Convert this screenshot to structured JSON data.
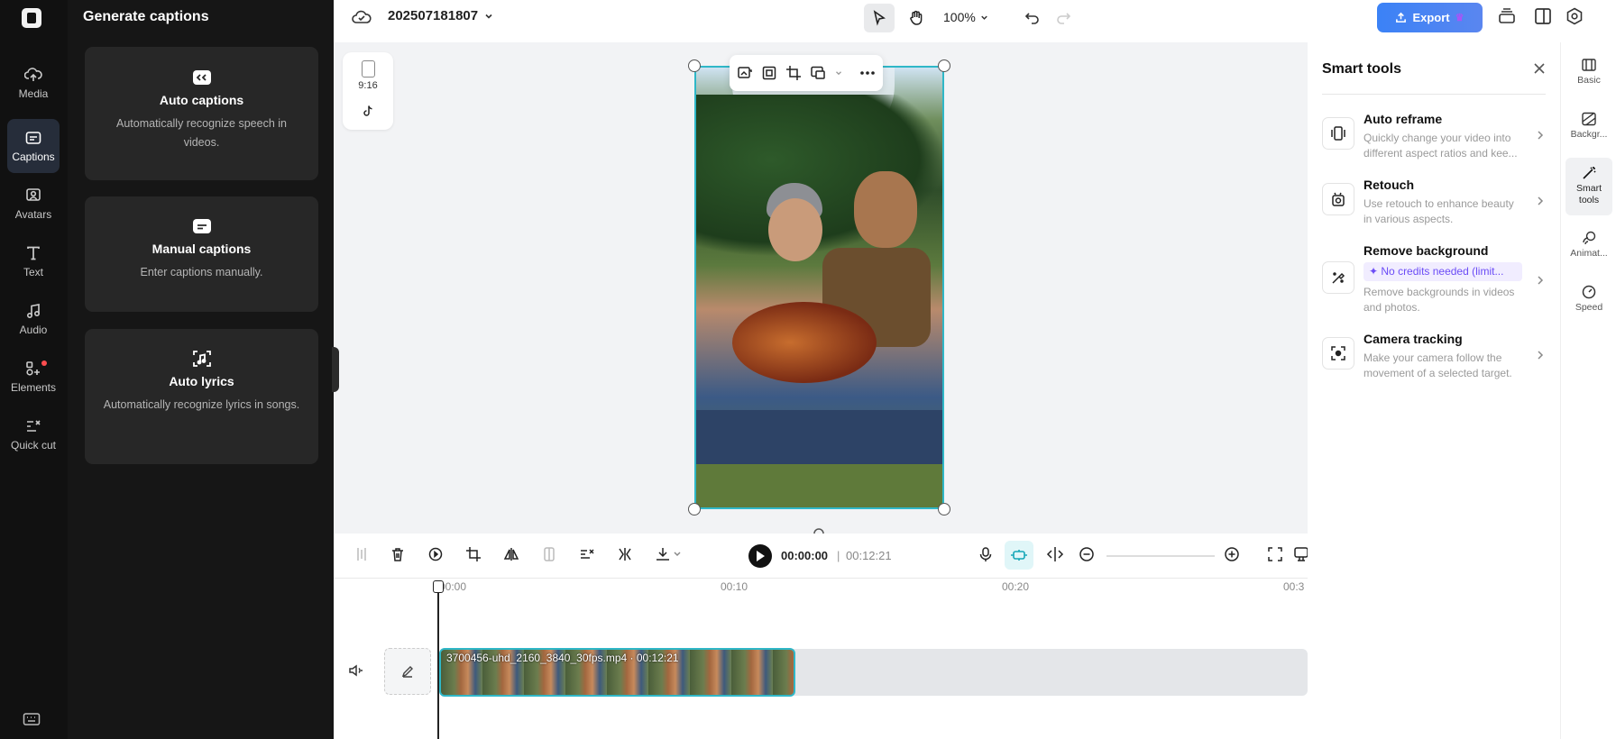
{
  "sidebar": {
    "items": [
      {
        "label": "Media",
        "icon": "cloud-upload-icon"
      },
      {
        "label": "Captions",
        "icon": "captions-icon"
      },
      {
        "label": "Avatars",
        "icon": "avatar-icon"
      },
      {
        "label": "Text",
        "icon": "text-icon"
      },
      {
        "label": "Audio",
        "icon": "music-note-icon"
      },
      {
        "label": "Elements",
        "icon": "elements-icon"
      },
      {
        "label": "Quick cut",
        "icon": "quick-cut-icon"
      }
    ],
    "active": "Captions"
  },
  "panel": {
    "title": "Generate captions",
    "cards": [
      {
        "title": "Auto captions",
        "desc": "Automatically recognize speech in videos."
      },
      {
        "title": "Manual captions",
        "desc": "Enter captions manually."
      },
      {
        "title": "Auto lyrics",
        "desc": "Automatically recognize lyrics in songs."
      }
    ]
  },
  "topbar": {
    "project_name": "202507181807",
    "zoom": "100%",
    "export_label": "Export"
  },
  "canvas": {
    "ratio": "9:16"
  },
  "timeline": {
    "current_time": "00:00:00",
    "separator": "|",
    "duration": "00:12:21",
    "ticks": [
      "00:00",
      "00:10",
      "00:20",
      "00:3"
    ],
    "clip_label": "3700456-uhd_2160_3840_30fps.mp4 · 00:12:21"
  },
  "smart_tools": {
    "title": "Smart tools",
    "tools": [
      {
        "name": "Auto reframe",
        "desc": "Quickly change your video into different aspect ratios and kee..."
      },
      {
        "name": "Retouch",
        "desc": "Use retouch to enhance beauty in various aspects."
      },
      {
        "name": "Remove background",
        "badge": "✦ No credits needed (limit...",
        "desc": "Remove backgrounds in videos and photos."
      },
      {
        "name": "Camera tracking",
        "desc": "Make your camera follow the movement of a selected target."
      }
    ]
  },
  "right_tabs": [
    {
      "label": "Basic"
    },
    {
      "label": "Backgr..."
    },
    {
      "label": "Smart tools"
    },
    {
      "label": "Animat..."
    },
    {
      "label": "Speed"
    }
  ],
  "colors": {
    "accent": "#3b82f6",
    "selection": "#2fb7c7",
    "badge_text": "#6b4cf6"
  }
}
